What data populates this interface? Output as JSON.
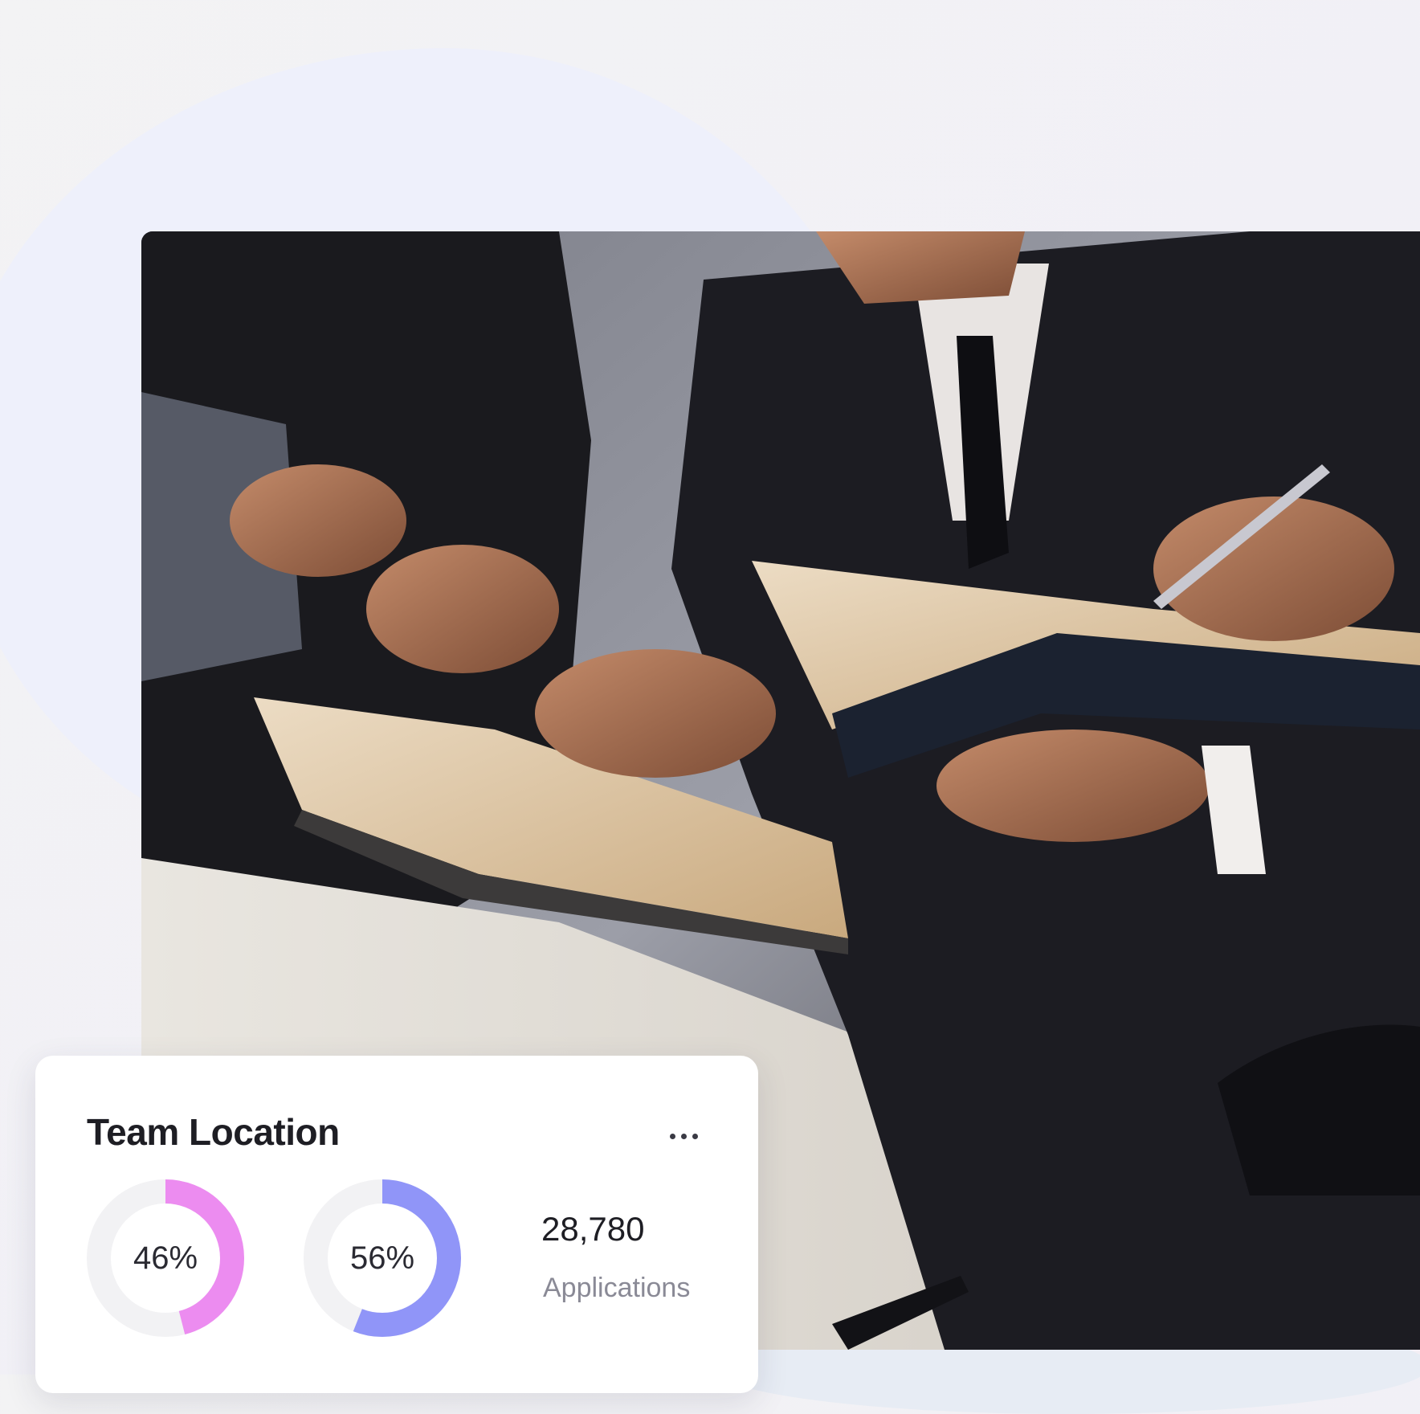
{
  "card": {
    "title": "Team Location",
    "more_icon": "more-horizontal-icon",
    "donuts": [
      {
        "label": "46%",
        "value": 0.46,
        "color": "#ec8cf0",
        "track_color": "#f2f2f4"
      },
      {
        "label": "56%",
        "value": 0.56,
        "color": "#9095f8",
        "track_color": "#f2f2f4"
      }
    ],
    "stat": {
      "value": "28,780",
      "label": "Applications"
    }
  },
  "colors": {
    "background": "#f3f2f5",
    "blob": "#eef0fb",
    "card": "#ffffff",
    "accent_pink": "#ec8cf0",
    "accent_blue": "#9095f8"
  }
}
